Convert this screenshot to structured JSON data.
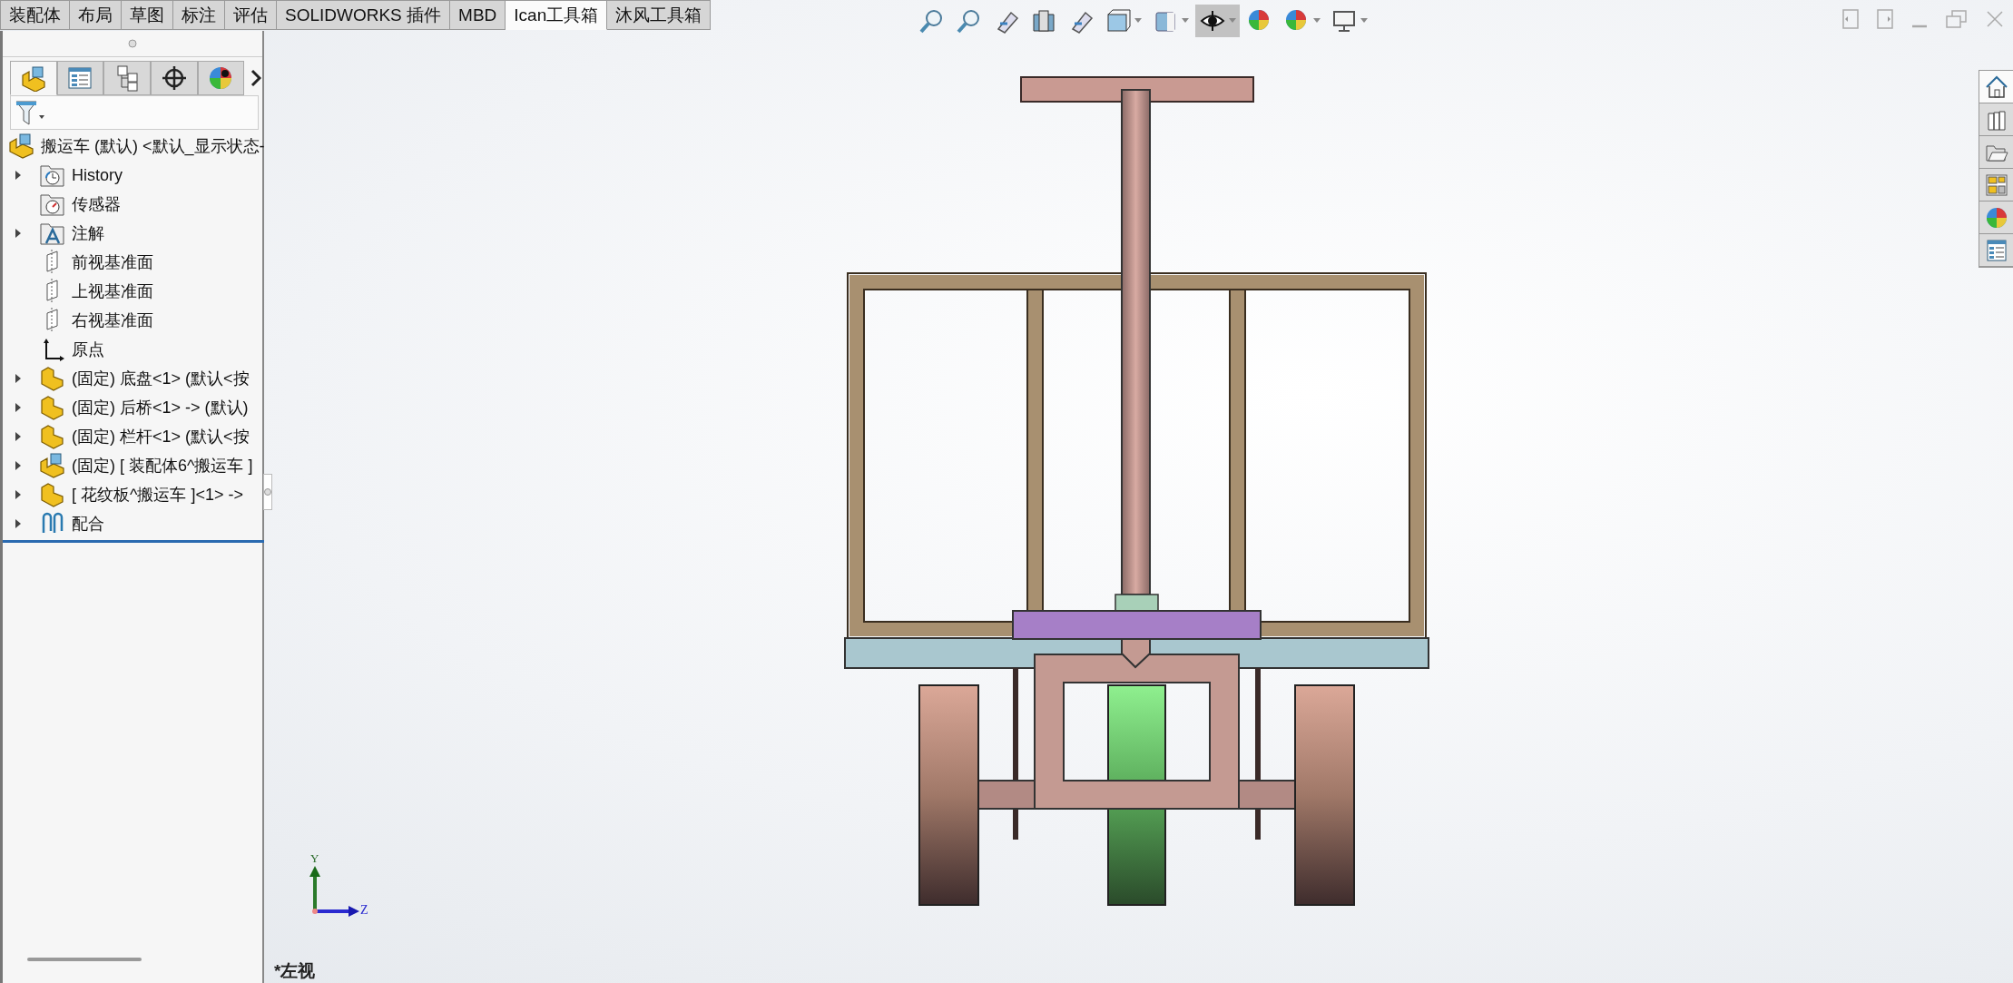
{
  "tabs": [
    {
      "label": "装配体",
      "selected": false
    },
    {
      "label": "布局",
      "selected": false
    },
    {
      "label": "草图",
      "selected": false
    },
    {
      "label": "标注",
      "selected": false
    },
    {
      "label": "评估",
      "selected": false
    },
    {
      "label": "SOLIDWORKS 插件",
      "selected": false
    },
    {
      "label": "MBD",
      "selected": false
    },
    {
      "label": "Ican工具箱",
      "selected": true
    },
    {
      "label": "沐风工具箱",
      "selected": false
    }
  ],
  "panel_tabs": [
    {
      "selected": true
    },
    {
      "selected": false
    },
    {
      "selected": false
    },
    {
      "selected": false
    },
    {
      "selected": false
    }
  ],
  "tree": {
    "label": "搬运车 (默认) <默认_显示状态-",
    "kind": "assembly",
    "children": [
      {
        "label": "History",
        "kind": "history",
        "expander": true
      },
      {
        "label": "传感器",
        "kind": "sensor",
        "expander": false
      },
      {
        "label": "注解",
        "kind": "annotation",
        "expander": true
      },
      {
        "label": "前视基准面",
        "kind": "plane",
        "expander": false
      },
      {
        "label": "上视基准面",
        "kind": "plane",
        "expander": false
      },
      {
        "label": "右视基准面",
        "kind": "plane",
        "expander": false
      },
      {
        "label": "原点",
        "kind": "origin",
        "expander": false
      },
      {
        "label": "(固定) 底盘<1> (默认<按",
        "kind": "part",
        "expander": true
      },
      {
        "label": "(固定) 后桥<1> -> (默认)",
        "kind": "part",
        "expander": true
      },
      {
        "label": "(固定) 栏杆<1> (默认<按",
        "kind": "part",
        "expander": true
      },
      {
        "label": "(固定) [ 装配体6^搬运车 ]",
        "kind": "assembly",
        "expander": true
      },
      {
        "label": "[ 花纹板^搬运车 ]<1> ->",
        "kind": "part",
        "expander": true
      },
      {
        "label": "配合",
        "kind": "mate",
        "expander": true
      }
    ]
  },
  "view_toolbar": [
    {
      "on": false,
      "dropdown": false
    },
    {
      "on": false,
      "dropdown": false
    },
    {
      "on": false,
      "dropdown": false
    },
    {
      "on": false,
      "dropdown": false
    },
    {
      "on": false,
      "dropdown": false
    },
    {
      "on": false,
      "dropdown": true
    },
    {
      "on": false,
      "dropdown": true
    },
    {
      "on": true,
      "dropdown": true
    },
    {
      "on": false,
      "dropdown": false
    },
    {
      "on": false,
      "dropdown": true
    },
    {
      "on": false,
      "dropdown": true
    }
  ],
  "task_pane": [
    {
      "selected": true
    },
    {
      "selected": false
    },
    {
      "selected": false
    },
    {
      "selected": false
    },
    {
      "selected": false
    },
    {
      "selected": false
    }
  ],
  "triad": {
    "y_label": "Y",
    "z_label": "Z"
  },
  "view_name": "*左视"
}
